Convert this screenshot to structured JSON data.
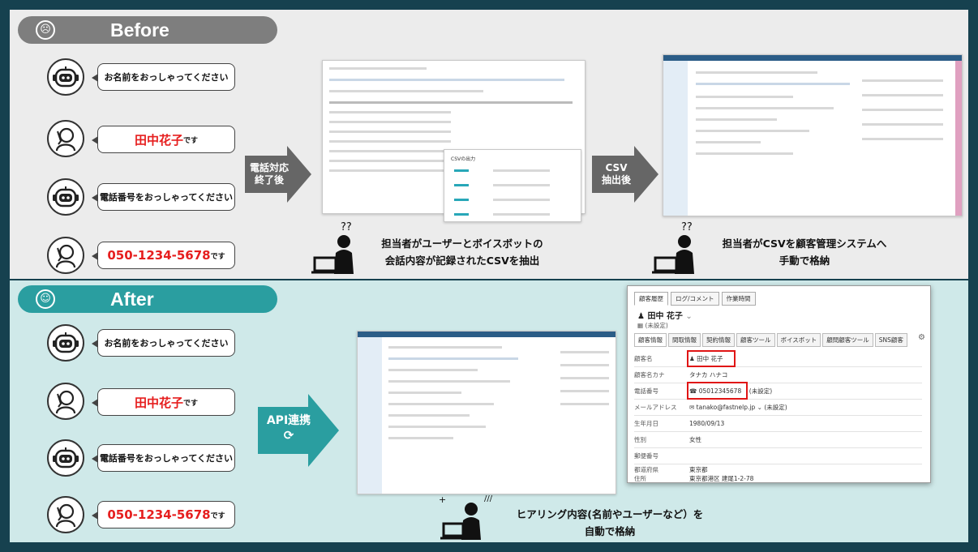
{
  "before": {
    "title": "Before",
    "bot_question_name": "お名前をおっしゃってください",
    "user_answer_name_red": "田中花子",
    "user_answer_name_suffix": "です",
    "bot_question_phone": "電話番号をおっしゃってください",
    "user_answer_phone_red": "050-1234-5678",
    "user_answer_phone_suffix": "です",
    "arrow1_line1": "電話対応",
    "arrow1_line2": "終了後",
    "csv_dialog_title": "CSVの出力",
    "arrow2_line1": "CSV",
    "arrow2_line2": "抽出後",
    "caption1_line1": "担当者がユーザーとボイスボットの",
    "caption1_line2": "会話内容が記録されたCSVを抽出",
    "caption2_line1": "担当者がCSVを顧客管理システムへ",
    "caption2_line2": "手動で格納"
  },
  "after": {
    "title": "After",
    "bot_question_name": "お名前をおっしゃってください",
    "user_answer_name_red": "田中花子",
    "user_answer_name_suffix": "です",
    "bot_question_phone": "電話番号をおっしゃってください",
    "user_answer_phone_red": "050-1234-5678",
    "user_answer_phone_suffix": "です",
    "arrow_label": "API連携",
    "caption_line1": "ヒアリング内容(名前やユーザーなど）を",
    "caption_line2": "自動で格納"
  },
  "crm": {
    "top_tabs": [
      "顧客履歴",
      "ログ/コメント",
      "作業時間"
    ],
    "customer_name": "田中 花子",
    "status_label": "(未設定)",
    "sub_tabs": [
      "顧客情報",
      "間取情報",
      "契約情報",
      "顧客ツール",
      "ボイスボット",
      "顧問顧客ツール",
      "SNS顧客"
    ],
    "fields": [
      {
        "label": "顧客名",
        "value": "田中 花子"
      },
      {
        "label": "顧客名カナ",
        "value": "タナカ ハナコ"
      },
      {
        "label": "電話番号",
        "value": "05012345678",
        "extra": "(未設定)"
      },
      {
        "label": "メールアドレス",
        "value": "tanako@fastnelp.jp",
        "extra": "(未設定)"
      },
      {
        "label": "生年月日",
        "value": "1980/09/13"
      },
      {
        "label": "性別",
        "value": "女性"
      },
      {
        "label": "郵便番号",
        "value": ""
      },
      {
        "label": "都道府県",
        "value": "東京都"
      },
      {
        "label": "住所",
        "value": "東京都港区 建尾1-2-78"
      }
    ]
  }
}
